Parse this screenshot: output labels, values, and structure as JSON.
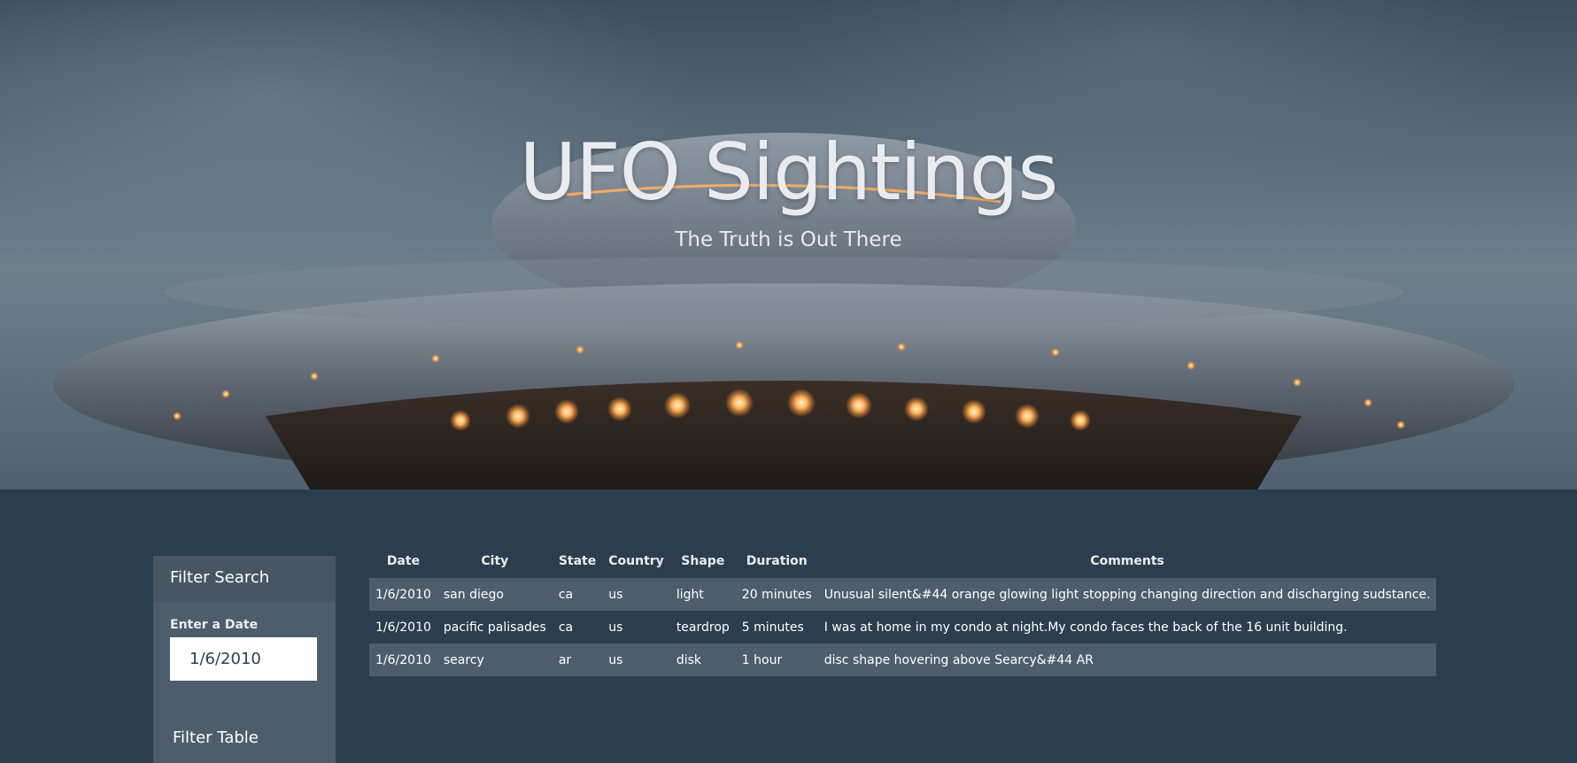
{
  "hero": {
    "title": "UFO Sightings",
    "subtitle": "The Truth is Out There"
  },
  "sidebar": {
    "heading": "Filter Search",
    "date_label": "Enter a Date",
    "date_value": "1/6/2010",
    "filter_table_title": "Filter Table"
  },
  "table": {
    "headers": [
      "Date",
      "City",
      "State",
      "Country",
      "Shape",
      "Duration",
      "Comments"
    ],
    "rows": [
      [
        "1/6/2010",
        "san diego",
        "ca",
        "us",
        "light",
        "20 minutes",
        "Unusual silent&#44 orange glowing light stopping changing direction and discharging sudstance."
      ],
      [
        "1/6/2010",
        "pacific palisades",
        "ca",
        "us",
        "teardrop",
        "5 minutes",
        "I was at home in my condo at night.My condo faces the back of the 16 unit building."
      ],
      [
        "1/6/2010",
        "searcy",
        "ar",
        "us",
        "disk",
        "1 hour",
        "disc shape hovering above Searcy&#44 AR"
      ]
    ]
  },
  "colors": {
    "page_background": "#2b3e50",
    "panel": "#4e5d6c",
    "striped_row": "#4e5d6c"
  }
}
